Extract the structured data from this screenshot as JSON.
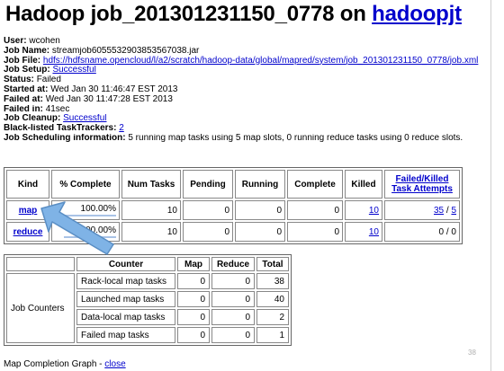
{
  "title": {
    "prefix": "Hadoop job_201301231150_0778 on ",
    "host_link": "hadoopjt"
  },
  "info": {
    "user_label": "User:",
    "user": "wcohen",
    "job_name_label": "Job Name:",
    "job_name": "streamjob6055532903853567038.jar",
    "job_file_label": "Job File:",
    "job_file": "hdfs://hdfsname.opencloud/l/a2/scratch/hadoop-data/global/mapred/system/job_201301231150_0778/job.xml",
    "job_setup_label": "Job Setup:",
    "job_setup": "Successful",
    "status_label": "Status:",
    "status": "Failed",
    "started_label": "Started at:",
    "started": "Wed Jan 30 11:46:47 EST 2013",
    "failed_at_label": "Failed at:",
    "failed_at": "Wed Jan 30 11:47:28 EST 2013",
    "failed_in_label": "Failed in:",
    "failed_in": "41sec",
    "cleanup_label": "Job Cleanup:",
    "cleanup": "Successful",
    "blacklisted_label": "Black-listed TaskTrackers:",
    "blacklisted": "2",
    "scheduling_label": "Job Scheduling information:",
    "scheduling": "5 running map tasks using 5 map slots, 0 running reduce tasks using 0 reduce slots."
  },
  "tasks_table": {
    "headers": {
      "kind": "Kind",
      "complete": "% Complete",
      "num": "Num Tasks",
      "pending": "Pending",
      "running": "Running",
      "completed": "Complete",
      "killed": "Killed",
      "failed": "Failed/Killed Task Attempts"
    },
    "rows": [
      {
        "kind": "map",
        "complete": "100.00%",
        "progress": 1.0,
        "num": "10",
        "pending": "0",
        "running": "0",
        "completed": "0",
        "killed": "10",
        "failed_a": "35",
        "failed_sep": " / ",
        "failed_b": "5"
      },
      {
        "kind": "reduce",
        "complete": "100.00%",
        "progress": 1.0,
        "num": "10",
        "pending": "0",
        "running": "0",
        "completed": "0",
        "killed": "10",
        "failed_a": "",
        "failed_sep": "",
        "failed_b": "0 / 0"
      }
    ]
  },
  "counters_table": {
    "headers": {
      "group": "",
      "counter": "Counter",
      "map": "Map",
      "reduce": "Reduce",
      "total": "Total"
    },
    "group": "Job Counters",
    "rows": [
      {
        "name": "Rack-local map tasks",
        "map": "0",
        "reduce": "0",
        "total": "38"
      },
      {
        "name": "Launched map tasks",
        "map": "0",
        "reduce": "0",
        "total": "40"
      },
      {
        "name": "Data-local map tasks",
        "map": "0",
        "reduce": "0",
        "total": "2"
      },
      {
        "name": "Failed map tasks",
        "map": "0",
        "reduce": "0",
        "total": "1"
      }
    ]
  },
  "footer": {
    "label": "Map Completion Graph - ",
    "close": "close"
  },
  "page_number": "38",
  "colors": {
    "link": "#0000cc",
    "arrow": "#7fb3e6",
    "arrow_stroke": "#5a8ec4",
    "progress": "#a9c3e6"
  }
}
